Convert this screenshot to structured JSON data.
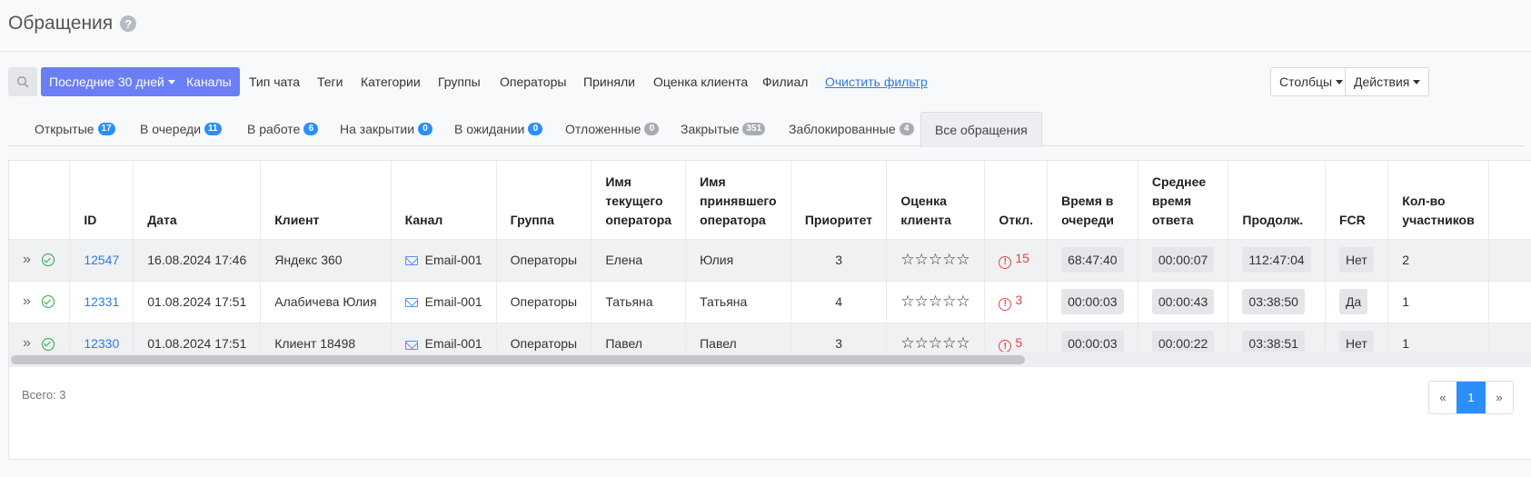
{
  "header": {
    "title": "Обращения",
    "help_glyph": "?"
  },
  "toolbar": {
    "date_range": "Последние 30 дней",
    "channels": "Каналы",
    "filters": [
      "Тип чата",
      "Теги",
      "Категории",
      "Группы",
      "Операторы",
      "Приняли",
      "Оценка клиента",
      "Филиал"
    ],
    "clear_filter": "Очистить фильтр",
    "columns": "Столбцы",
    "actions": "Действия"
  },
  "tabs": [
    {
      "label": "Открытые",
      "count": "17"
    },
    {
      "label": "В очереди",
      "count": "11"
    },
    {
      "label": "В работе",
      "count": "6"
    },
    {
      "label": "На закрытии",
      "count": "0"
    },
    {
      "label": "В ожидании",
      "count": "0"
    },
    {
      "label": "Отложенные",
      "count": "0"
    },
    {
      "label": "Закрытые",
      "count": "351"
    },
    {
      "label": "Заблокированные",
      "count": "4"
    },
    {
      "label": "Все обращения",
      "count": ""
    }
  ],
  "table": {
    "headers": {
      "id": "ID",
      "date": "Дата",
      "client": "Клиент",
      "channel": "Канал",
      "group": "Группа",
      "cur_op_1": "Имя",
      "cur_op_2": "текущего",
      "cur_op_3": "оператора",
      "acc_op_1": "Имя",
      "acc_op_2": "принявшего",
      "acc_op_3": "оператора",
      "priority": "Приоритет",
      "rating_1": "Оценка",
      "rating_2": "клиента",
      "rejected": "Откл.",
      "queue_1": "Время в",
      "queue_2": "очереди",
      "avg_1": "Среднее",
      "avg_2": "время",
      "avg_3": "ответа",
      "duration": "Продолж.",
      "fcr": "FCR",
      "participants_1": "Кол-во",
      "participants_2": "участников"
    },
    "rows": [
      {
        "id": "12547",
        "date": "16.08.2024 17:46",
        "client": "Яндекс 360",
        "channel": "Email-001",
        "group": "Операторы",
        "cur_op": "Елена",
        "acc_op": "Юлия",
        "priority": "3",
        "stars": "☆☆☆☆☆",
        "rejected": "15",
        "queue": "68:47:40",
        "avg": "00:00:07",
        "duration": "112:47:04",
        "fcr": "Нет",
        "participants": "2"
      },
      {
        "id": "12331",
        "date": "01.08.2024 17:51",
        "client": "Алабичева Юлия",
        "channel": "Email-001",
        "group": "Операторы",
        "cur_op": "Татьяна",
        "acc_op": "Татьяна",
        "priority": "4",
        "stars": "☆☆☆☆☆",
        "rejected": "3",
        "queue": "00:00:03",
        "avg": "00:00:43",
        "duration": "03:38:50",
        "fcr": "Да",
        "participants": "1"
      },
      {
        "id": "12330",
        "date": "01.08.2024 17:51",
        "client": "Клиент 18498",
        "channel": "Email-001",
        "group": "Операторы",
        "cur_op": "Павел",
        "acc_op": "Павел",
        "priority": "3",
        "stars": "☆☆☆☆☆",
        "rejected": "5",
        "queue": "00:00:03",
        "avg": "00:00:22",
        "duration": "03:38:51",
        "fcr": "Нет",
        "participants": "1"
      }
    ],
    "expand_glyph": "»"
  },
  "footer": {
    "total": "Всего: 3",
    "pager_prev": "«",
    "pager_current": "1",
    "pager_next": "»"
  },
  "colors": {
    "primary": "#6b7ef5",
    "link": "#2c7be5",
    "badge_blue": "#2c8ef8",
    "badge_gray": "#a9adb3",
    "warning": "#e04848",
    "success": "#28a745"
  }
}
